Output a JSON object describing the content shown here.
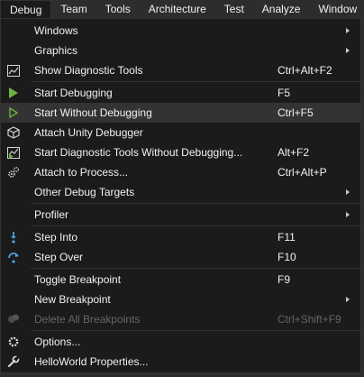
{
  "menubar": {
    "items": [
      {
        "label": "Debug"
      },
      {
        "label": "Team"
      },
      {
        "label": "Tools"
      },
      {
        "label": "Architecture"
      },
      {
        "label": "Test"
      },
      {
        "label": "Analyze"
      },
      {
        "label": "Window"
      }
    ]
  },
  "menu": {
    "windows": "Windows",
    "graphics": "Graphics",
    "show_diag": {
      "label": "Show Diagnostic Tools",
      "shortcut": "Ctrl+Alt+F2"
    },
    "start_debugging": {
      "label": "Start Debugging",
      "shortcut": "F5"
    },
    "start_without": {
      "label": "Start Without Debugging",
      "shortcut": "Ctrl+F5"
    },
    "attach_unity": {
      "label": "Attach Unity Debugger"
    },
    "start_diag_without": {
      "label": "Start Diagnostic Tools Without Debugging...",
      "shortcut": "Alt+F2"
    },
    "attach_process": {
      "label": "Attach to Process...",
      "shortcut": "Ctrl+Alt+P"
    },
    "other_targets": "Other Debug Targets",
    "profiler": "Profiler",
    "step_into": {
      "label": "Step Into",
      "shortcut": "F11"
    },
    "step_over": {
      "label": "Step Over",
      "shortcut": "F10"
    },
    "toggle_bp": {
      "label": "Toggle Breakpoint",
      "shortcut": "F9"
    },
    "new_bp": "New Breakpoint",
    "delete_all_bp": {
      "label": "Delete All Breakpoints",
      "shortcut": "Ctrl+Shift+F9"
    },
    "options": "Options...",
    "properties": "HelloWorld Properties..."
  },
  "colors": {
    "play_green": "#6db33f",
    "step_blue": "#4aa3df",
    "text": "#f1f1f1",
    "disabled": "#656565"
  }
}
